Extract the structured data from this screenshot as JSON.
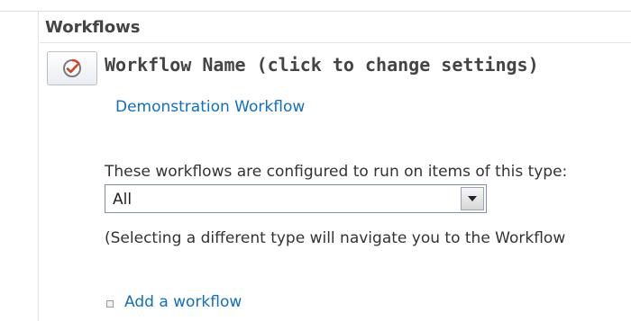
{
  "section": {
    "title": "Workflows"
  },
  "table": {
    "column_header": "Workflow Name (click to change settings)",
    "rows": [
      {
        "name": "Demonstration Workflow"
      }
    ]
  },
  "type_selector": {
    "label": "These workflows are configured to run on items of this type:",
    "selected": "All",
    "hint": "(Selecting a different type will navigate you to the Workflow"
  },
  "actions": {
    "add_workflow": "Add a workflow"
  },
  "icons": {
    "settings_button": "workflow-settings-icon",
    "dropdown_arrow": "chevron-down-icon",
    "bullet": "bullet-icon"
  },
  "colors": {
    "link": "#0f6fc6",
    "workflow_icon_accent": "#d9401a"
  }
}
